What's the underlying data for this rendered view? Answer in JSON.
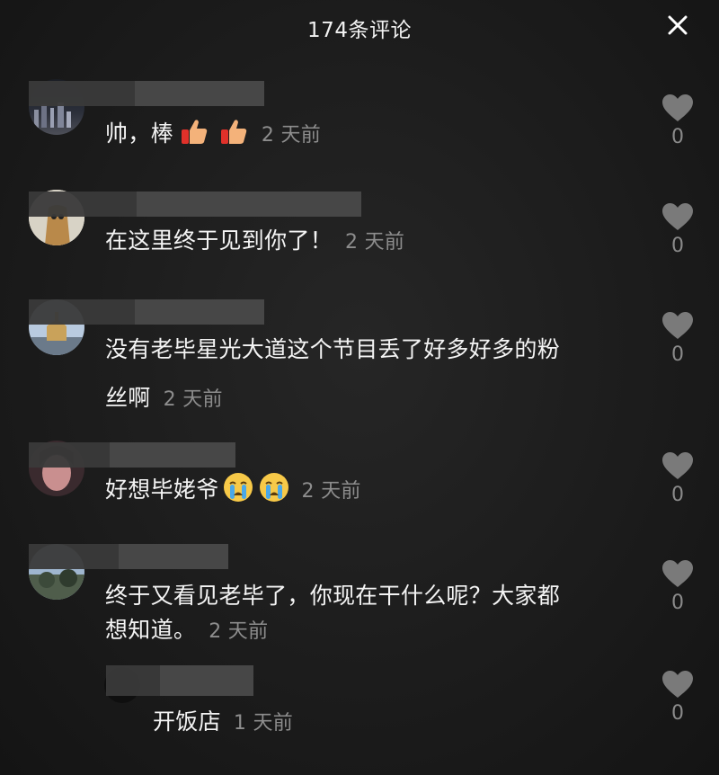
{
  "header": {
    "title": "174条评论"
  },
  "comments": [
    {
      "text": "帅，棒",
      "emojis": [
        "thumbs-up",
        "thumbs-up"
      ],
      "time": "2 天前",
      "likes": "0"
    },
    {
      "text": "在这里终于见到你了！",
      "time": "2 天前",
      "likes": "0"
    },
    {
      "text_line1": "没有老毕星光大道这个节目丢了好多好多的粉",
      "text_line2": "丝啊",
      "time": "2 天前",
      "likes": "0"
    },
    {
      "text": "好想毕姥爷",
      "emojis": [
        "crying-face",
        "crying-face"
      ],
      "time": "2 天前",
      "likes": "0"
    },
    {
      "text_line1": "终于又看见老毕了，你现在干什么呢？大家都",
      "text_line2": "想知道。",
      "time": "2 天前",
      "likes": "0"
    }
  ],
  "reply": {
    "text": "开饭店",
    "time": "1 天前",
    "likes": "0"
  },
  "colors": {
    "background": "#1c1c1c",
    "text": "#f4f4f4",
    "timestamp": "#8d8d8d",
    "heart": "#7a7a7a"
  }
}
